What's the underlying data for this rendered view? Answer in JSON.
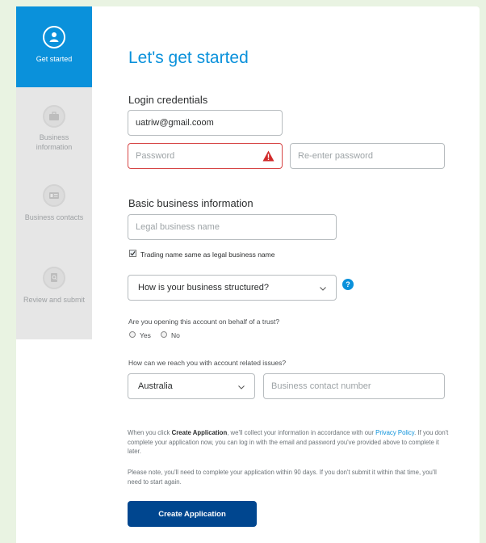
{
  "sidebar": {
    "steps": [
      {
        "label": "Get started",
        "icon": "user-icon",
        "active": true
      },
      {
        "label": "Business information",
        "icon": "briefcase-icon",
        "active": false
      },
      {
        "label": "Business contacts",
        "icon": "contact-card-icon",
        "active": false
      },
      {
        "label": "Review and submit",
        "icon": "review-document-icon",
        "active": false
      }
    ]
  },
  "main": {
    "title": "Let's get started",
    "login_section_title": "Login credentials",
    "email_value": "uatriw@gmail.coom",
    "password_placeholder": "Password",
    "reenter_placeholder": "Re-enter password",
    "business_section_title": "Basic business information",
    "legal_name_placeholder": "Legal business name",
    "trading_checkbox_label": "Trading name same as legal business name",
    "structure_select_value": "How is your business structured?",
    "help_icon_text": "?",
    "trust_question": "Are you opening this account on behalf of a trust?",
    "trust_options": [
      "Yes",
      "No"
    ],
    "reach_question": "How can we reach you with account related issues?",
    "country_select_value": "Australia",
    "contact_number_placeholder": "Business contact number",
    "consent_prefix": "When you click ",
    "consent_bold": "Create Application",
    "consent_mid": ", we'll collect your information in accordance with our ",
    "consent_link": "Privacy Policy",
    "consent_suffix": ". If you don't complete your application now, you can log in with the email and password you've provided above to complete it later.",
    "note_text": "Please note, you'll need to complete your application within 90 days. If you don't submit it within that time, you'll need to start again.",
    "create_button_label": "Create Application"
  },
  "colors": {
    "brand_blue": "#0a91db",
    "button_navy": "#00468f",
    "error_red": "#d64545",
    "page_background": "#e9f3e2"
  }
}
